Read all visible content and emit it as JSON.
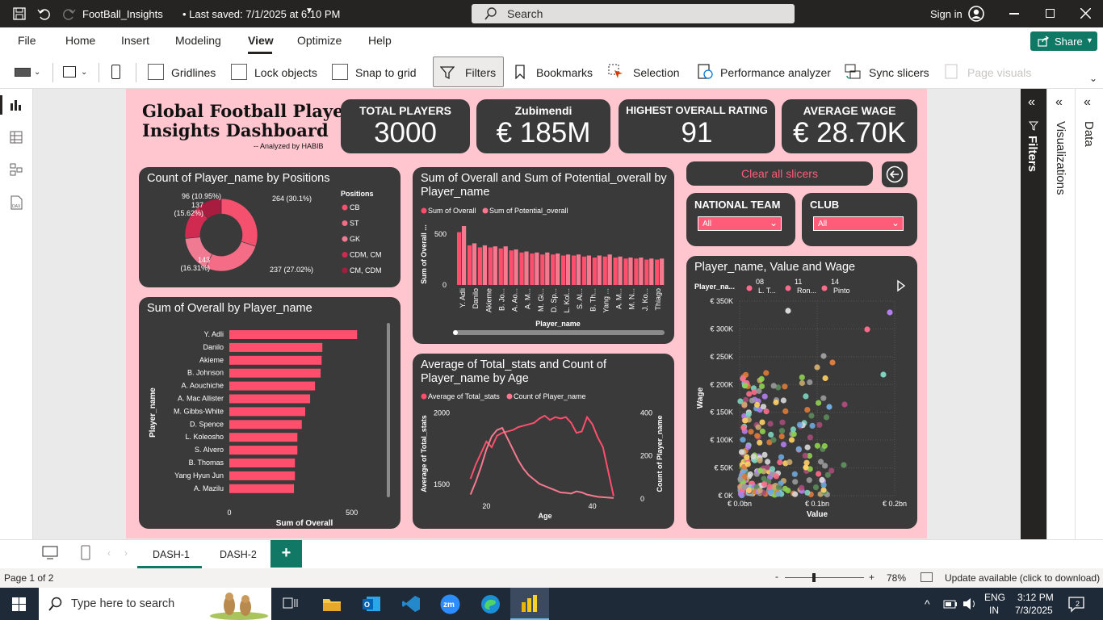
{
  "titlebar": {
    "file_title": "FootBall_Insights",
    "saved": "• Last saved: 7/1/2025 at 6:10 PM",
    "search_placeholder": "Search",
    "sign_in": "Sign in"
  },
  "menu": {
    "items": [
      "File",
      "Home",
      "Insert",
      "Modeling",
      "View",
      "Optimize",
      "Help"
    ],
    "active": "View",
    "share": "Share"
  },
  "toolbar": {
    "gridlines": "Gridlines",
    "lock_objects": "Lock objects",
    "snap_to_grid": "Snap to grid",
    "filters": "Filters",
    "bookmarks": "Bookmarks",
    "selection": "Selection",
    "performance_analyzer": "Performance analyzer",
    "sync_slicers": "Sync slicers",
    "page_visuals": "Page visuals"
  },
  "dashboard": {
    "title_line1": "Global Football Player",
    "title_line2": "Insights Dashboard",
    "byline": "-- Analyzed by HABIB",
    "kpis": [
      {
        "label": "TOTAL PLAYERS",
        "value": "3000"
      },
      {
        "label": "Zubimendi",
        "value": "€ 185M"
      },
      {
        "label": "HIGHEST OVERALL RATING",
        "value": "91"
      },
      {
        "label": "AVERAGE WAGE",
        "value": "€ 28.70K"
      }
    ],
    "clear_slicers": "Clear all slicers",
    "slicers": [
      {
        "label": "NATIONAL TEAM",
        "value": "All"
      },
      {
        "label": "CLUB",
        "value": "All"
      }
    ]
  },
  "chart_data": [
    {
      "type": "pie",
      "title": "Count of Player_name by Positions",
      "legend_title": "Positions",
      "categories": [
        "CB",
        "ST",
        "GK",
        "CDM, CM",
        "CM, CDM"
      ],
      "values": [
        264,
        237,
        143,
        137,
        96
      ],
      "labels": [
        "264 (30.1%)",
        "237 (27.02%)",
        "143\n(16.31%)",
        "137\n(15.62%)",
        "96 (10.95%)"
      ],
      "colors": [
        "#f5506e",
        "#f56c86",
        "#f07a92",
        "#d12a50",
        "#a81d3f"
      ]
    },
    {
      "type": "bar",
      "title": "Sum of Overall and Sum of Potential_overall by Player_name",
      "series": [
        {
          "name": "Sum of Overall",
          "values": [
            520,
            390,
            370,
            370,
            360,
            340,
            320,
            310,
            300,
            300,
            290,
            290,
            280,
            270,
            280,
            270,
            260,
            260,
            250,
            250
          ]
        },
        {
          "name": "Sum of Potential_overall",
          "values": [
            580,
            410,
            390,
            380,
            380,
            350,
            330,
            320,
            320,
            310,
            300,
            300,
            290,
            290,
            300,
            280,
            270,
            270,
            260,
            260
          ]
        }
      ],
      "categories": [
        "Y. Adli",
        "Danilo",
        "Akieme",
        "B. Jo...",
        "A. Ao...",
        "A. M...",
        "M. Gi...",
        "D. Sp...",
        "L. Kol...",
        "S. Al...",
        "B. Th...",
        "Yang ...",
        "A. M...",
        "M. N...",
        "J. Ko...",
        "Thiago"
      ],
      "xlabel": "Player_name",
      "ylabel": "Sum of Overall ...",
      "yticks": [
        0,
        500
      ],
      "ylim": [
        0,
        620
      ]
    },
    {
      "type": "bar",
      "title": "Sum of Overall by Player_name",
      "categories": [
        "Y. Adli",
        "Danilo",
        "Akieme",
        "B. Johnson",
        "A. Aouchiche",
        "A. Mac Allister",
        "M. Gibbs-White",
        "D. Spence",
        "L. Koleosho",
        "S. Alvero",
        "B. Thomas",
        "Yang Hyun Jun",
        "A. Mazilu"
      ],
      "values": [
        522,
        380,
        377,
        373,
        350,
        330,
        310,
        296,
        278,
        278,
        268,
        268,
        264
      ],
      "xlabel": "Sum of Overall",
      "ylabel": "Player_name",
      "xticks": [
        0,
        500
      ],
      "xlim": [
        0,
        620
      ]
    },
    {
      "type": "line",
      "title": "Average of Total_stats and Count of Player_name by Age",
      "series": [
        {
          "name": "Average of Total_stats",
          "x": [
            17,
            18,
            19,
            20,
            21,
            22,
            23,
            24,
            25,
            26,
            27,
            28,
            29,
            30,
            31,
            32,
            33,
            34,
            35,
            36,
            37,
            38,
            39,
            40,
            41,
            42,
            43,
            44
          ],
          "values": [
            1540,
            1640,
            1720,
            1800,
            1760,
            1840,
            1860,
            1870,
            1880,
            1900,
            1910,
            1920,
            1930,
            1960,
            1980,
            1950,
            1970,
            1960,
            1970,
            1930,
            1860,
            1870,
            1970,
            1920,
            1830,
            1760,
            1590,
            1420
          ]
        },
        {
          "name": "Count of Player_name",
          "x": [
            17,
            18,
            19,
            20,
            21,
            22,
            23,
            24,
            25,
            26,
            27,
            28,
            29,
            30,
            31,
            32,
            33,
            34,
            35,
            36,
            37,
            38,
            39,
            40,
            41,
            42,
            43,
            44
          ],
          "values": [
            20,
            80,
            150,
            230,
            290,
            320,
            330,
            280,
            230,
            180,
            140,
            110,
            90,
            70,
            60,
            50,
            40,
            30,
            28,
            25,
            35,
            30,
            20,
            15,
            10,
            8,
            6,
            4
          ]
        }
      ],
      "xlabel": "Age",
      "ylabel": "Average of Total_stats",
      "y2label": "Count of Player_name",
      "xticks": [
        20,
        40
      ],
      "yticks": [
        1500,
        2000
      ],
      "y2ticks": [
        0,
        200,
        400
      ],
      "ylim": [
        1400,
        2030
      ],
      "y2lim": [
        0,
        420
      ]
    },
    {
      "type": "scatter",
      "title": "Player_name, Value and Wage",
      "legend_title": "Player_na...",
      "legend": [
        "08 L. T...",
        "11 Ron...",
        "14 Pinto"
      ],
      "xlabel": "Value",
      "ylabel": "Wage",
      "xticks": [
        "€ 0.0bn",
        "€ 0.1bn",
        "€ 0.2bn"
      ],
      "yticks": [
        "€ 0K",
        "€ 50K",
        "€ 100K",
        "€ 150K",
        "€ 200K",
        "€ 250K",
        "€ 300K",
        "€ 350K"
      ],
      "xlim": [
        0,
        0.2
      ],
      "ylim": [
        0,
        350
      ]
    }
  ],
  "pages": {
    "tabs": [
      "DASH-1",
      "DASH-2"
    ],
    "active": "DASH-1"
  },
  "panes": {
    "filters": "Filters",
    "visualizations": "Visualizations",
    "data": "Data"
  },
  "status": {
    "page": "Page 1 of 2",
    "zoom": "78%",
    "update": "Update available (click to download)"
  },
  "taskbar": {
    "search": "Type here to search",
    "lang1": "ENG",
    "lang2": "IN",
    "time": "3:12 PM",
    "date": "7/3/2025",
    "badge": "2"
  }
}
